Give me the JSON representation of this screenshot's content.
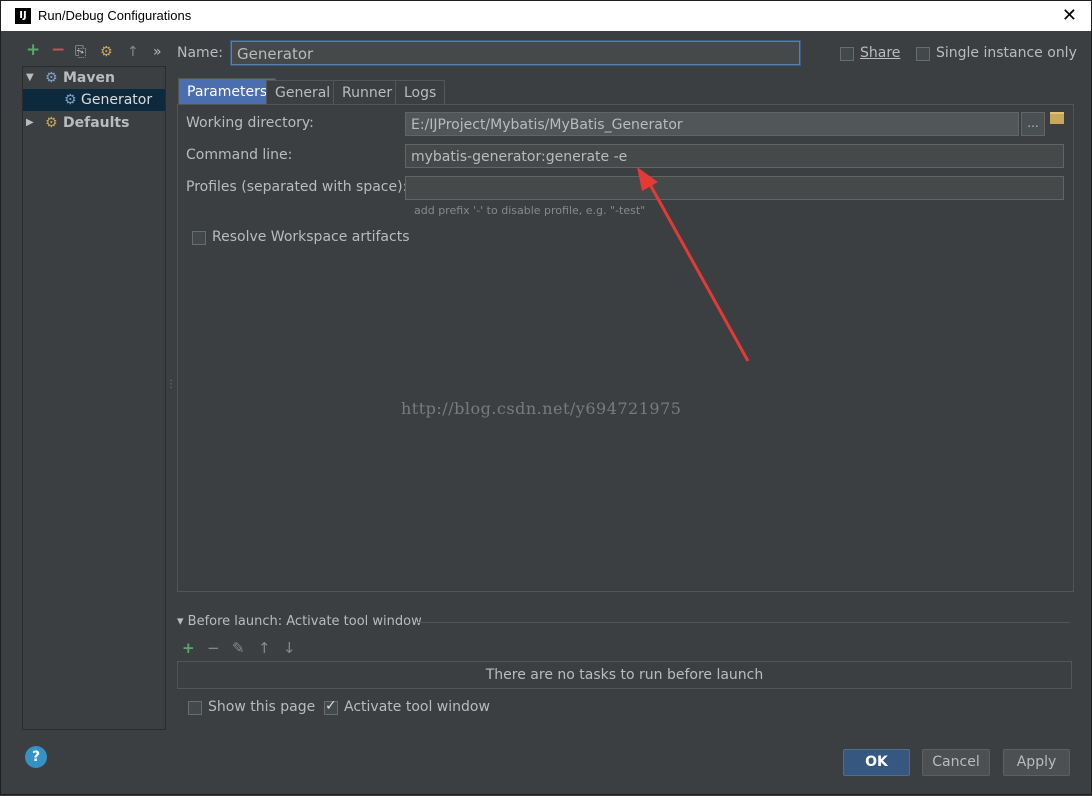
{
  "window": {
    "title": "Run/Debug Configurations",
    "app_icon_text": "IJ",
    "close_glyph": "✕"
  },
  "left_toolbar": {
    "add": "+",
    "remove": "−",
    "copy": "⎘",
    "settings": "⚙",
    "up": "↑",
    "more": "»"
  },
  "tree": {
    "maven": {
      "label": "Maven",
      "expanded": true
    },
    "generator": {
      "label": "Generator",
      "selected": true
    },
    "defaults": {
      "label": "Defaults",
      "expanded": false
    }
  },
  "name_field": {
    "label": "Name:",
    "value": "Generator"
  },
  "share": {
    "label": "Share",
    "checked": false
  },
  "single_instance": {
    "label": "Single instance only",
    "checked": false
  },
  "tabs": [
    {
      "label": "Parameters",
      "active": true
    },
    {
      "label": "General",
      "active": false
    },
    {
      "label": "Runner",
      "active": false
    },
    {
      "label": "Logs",
      "active": false
    }
  ],
  "parameters": {
    "working_directory": {
      "label": "Working directory:",
      "value": "E:/IJProject/Mybatis/MyBatis_Generator",
      "browse_label": "..."
    },
    "command_line": {
      "label": "Command line:",
      "value": "mybatis-generator:generate -e"
    },
    "profiles": {
      "label": "Profiles (separated with space):",
      "value": "",
      "hint": "add prefix '-' to disable profile, e.g. \"-test\""
    },
    "resolve_workspace": {
      "label": "Resolve Workspace artifacts",
      "checked": false
    }
  },
  "watermark": "http://blog.csdn.net/y694721975",
  "before_launch": {
    "header": "Before launch: Activate tool window",
    "empty_text": "There are no tasks to run before launch",
    "tools": {
      "add": "+",
      "remove": "−",
      "edit": "✎",
      "up": "↑",
      "down": "↓"
    }
  },
  "show_this_page": {
    "label": "Show this page",
    "checked": false
  },
  "activate_tool_window": {
    "label": "Activate tool window",
    "checked": true
  },
  "buttons": {
    "help": "?",
    "ok": "OK",
    "cancel": "Cancel",
    "apply": "Apply"
  },
  "colors": {
    "annotation_arrow": "#e53935",
    "selection": "#0d293e",
    "active_tab": "#4b6eaf",
    "primary_button": "#365880"
  }
}
